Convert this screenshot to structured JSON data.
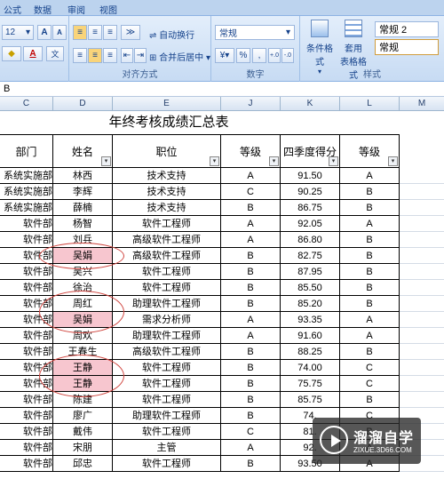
{
  "tabs": [
    "公式",
    "数据",
    "审阅",
    "视图"
  ],
  "ribbon": {
    "font_size": "12",
    "inc_font": "A",
    "dec_font": "A",
    "font_color_letter": "A",
    "wrap_text": "自动换行",
    "merge_center": "合并后居中",
    "number_format": "常规",
    "percent": "%",
    "comma": ",",
    "dec_inc": ".0→.00",
    "dec_dec": ".00→.0",
    "cond_format": "条件格式",
    "table_format_top": "套用",
    "table_format_bottom": "表格格式",
    "style1": "常规 2",
    "style2": "常规",
    "groups": {
      "alignment": "对齐方式",
      "number": "数字",
      "styles": "样式"
    }
  },
  "formula_bar": {
    "value": "B"
  },
  "columns": [
    "C",
    "D",
    "E",
    "J",
    "K",
    "L",
    "M"
  ],
  "sheet": {
    "title": "年终考核成绩汇总表",
    "headers": [
      "部门",
      "姓名",
      "职位",
      "等级",
      "四季度得分",
      "等级"
    ],
    "rows": [
      [
        "系统实施部",
        "林西",
        "技术支持",
        "A",
        "91.50",
        "A"
      ],
      [
        "系统实施部",
        "李辉",
        "技术支持",
        "C",
        "90.25",
        "B"
      ],
      [
        "系统实施部",
        "薛楠",
        "技术支持",
        "B",
        "86.75",
        "B"
      ],
      [
        "软件部",
        "杨智",
        "软件工程师",
        "A",
        "92.05",
        "A"
      ],
      [
        "软件部",
        "刘兵",
        "高级软件工程师",
        "A",
        "86.80",
        "B"
      ],
      [
        "软件部",
        "吴娟",
        "高级软件工程师",
        "B",
        "82.75",
        "B"
      ],
      [
        "软件部",
        "吴兴",
        "软件工程师",
        "B",
        "87.95",
        "B"
      ],
      [
        "软件部",
        "徐治",
        "软件工程师",
        "B",
        "85.50",
        "B"
      ],
      [
        "软件部",
        "周红",
        "助理软件工程师",
        "B",
        "85.20",
        "B"
      ],
      [
        "软件部",
        "吴娟",
        "需求分析师",
        "A",
        "93.35",
        "A"
      ],
      [
        "软件部",
        "周欢",
        "助理软件工程师",
        "A",
        "91.60",
        "A"
      ],
      [
        "软件部",
        "王春生",
        "高级软件工程师",
        "B",
        "88.25",
        "B"
      ],
      [
        "软件部",
        "王静",
        "软件工程师",
        "B",
        "74.00",
        "C"
      ],
      [
        "软件部",
        "王静",
        "软件工程师",
        "B",
        "75.75",
        "C"
      ],
      [
        "软件部",
        "陈建",
        "软件工程师",
        "B",
        "85.75",
        "B"
      ],
      [
        "软件部",
        "廖广",
        "助理软件工程师",
        "B",
        "74.",
        "C"
      ],
      [
        "软件部",
        "戴伟",
        "软件工程师",
        "C",
        "81.",
        "B"
      ],
      [
        "软件部",
        "宋朋",
        "主管",
        "A",
        "92.",
        "A"
      ],
      [
        "软件部",
        "邱忠",
        "软件工程师",
        "B",
        "93.50",
        "A"
      ]
    ],
    "highlight_rows": [
      5,
      9,
      12,
      13
    ]
  },
  "watermark": {
    "title": "溜溜自学",
    "url": "ZIXUE.3D66.COM"
  }
}
